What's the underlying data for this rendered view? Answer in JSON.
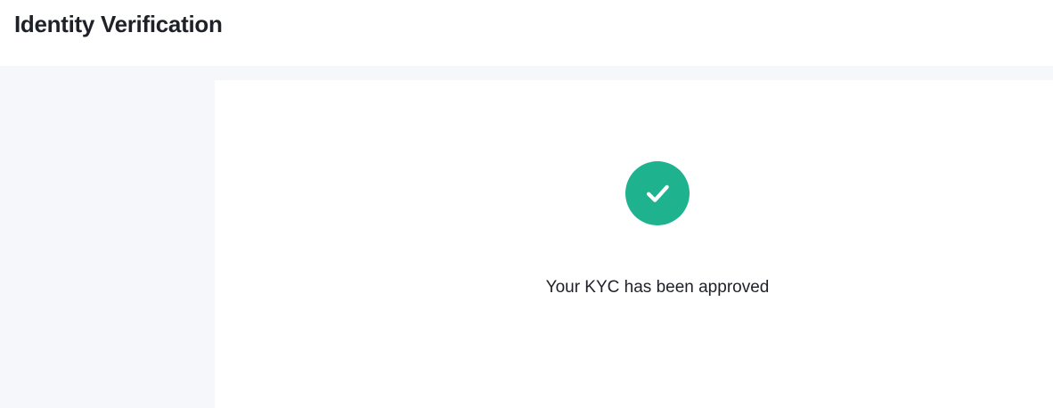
{
  "header": {
    "title": "Identity Verification"
  },
  "verification": {
    "status_icon": "check-circle-icon",
    "status_message": "Your KYC has been approved",
    "status_color": "#1eb28f"
  },
  "colors": {
    "page_background": "#f6f7fb",
    "card_background": "#ffffff",
    "text_primary": "#1f2128"
  }
}
